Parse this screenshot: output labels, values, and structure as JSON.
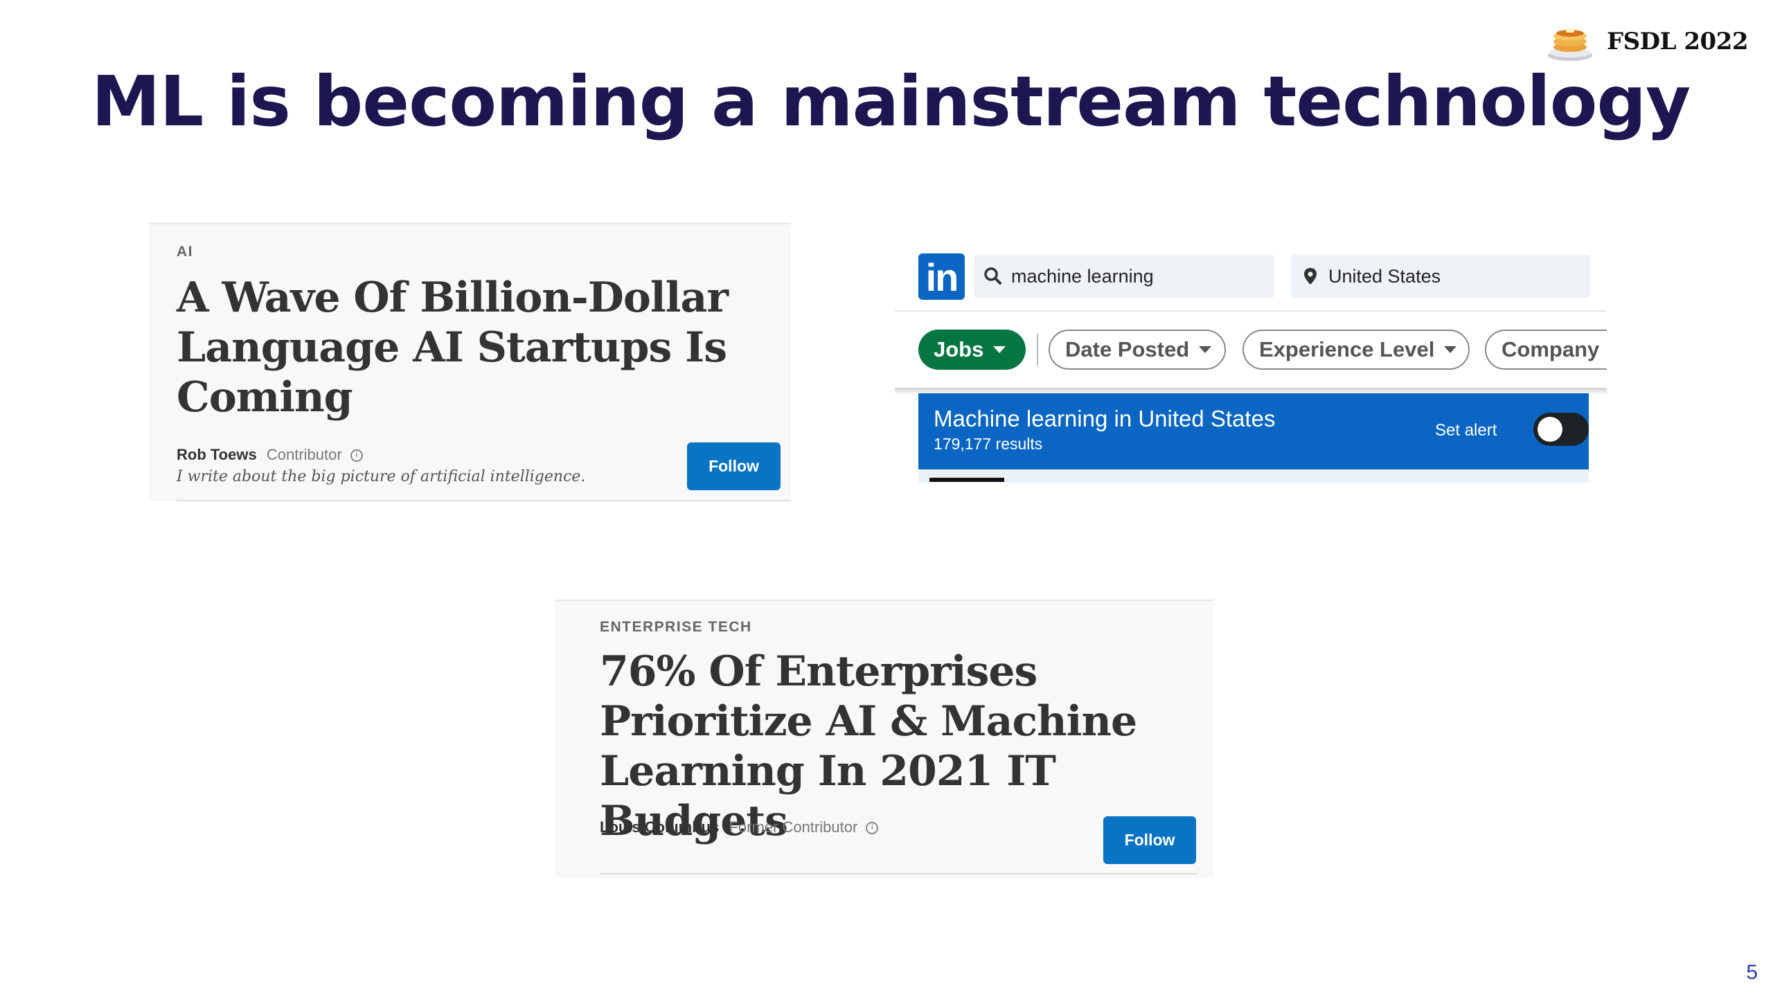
{
  "header": {
    "brand": "FSDL 2022",
    "title": "ML is becoming a mainstream technology",
    "page_number": "5"
  },
  "article1": {
    "section": "AI",
    "headline": "A Wave Of Billion-Dollar Language AI Startups Is Coming",
    "author": "Rob Toews",
    "role": "Contributor",
    "bio": "I write about the big picture of artificial intelligence.",
    "follow_label": "Follow"
  },
  "linkedin": {
    "logo_text": "in",
    "search_value": "machine learning",
    "location_value": "United States",
    "filters": {
      "jobs": "Jobs",
      "date_posted": "Date Posted",
      "experience_level": "Experience Level",
      "company": "Company"
    },
    "banner": {
      "title": "Machine learning in United States",
      "results": "179,177 results",
      "alert_label": "Set alert",
      "alert_on": false
    },
    "colors": {
      "brand": "#0a66c2",
      "jobs_pill": "#057642"
    }
  },
  "article2": {
    "section": "ENTERPRISE TECH",
    "headline": "76% Of Enterprises Prioritize AI & Machine Learning In 2021 IT Budgets",
    "author": "Louis Columbus",
    "role": "Former Contributor",
    "follow_label": "Follow"
  }
}
